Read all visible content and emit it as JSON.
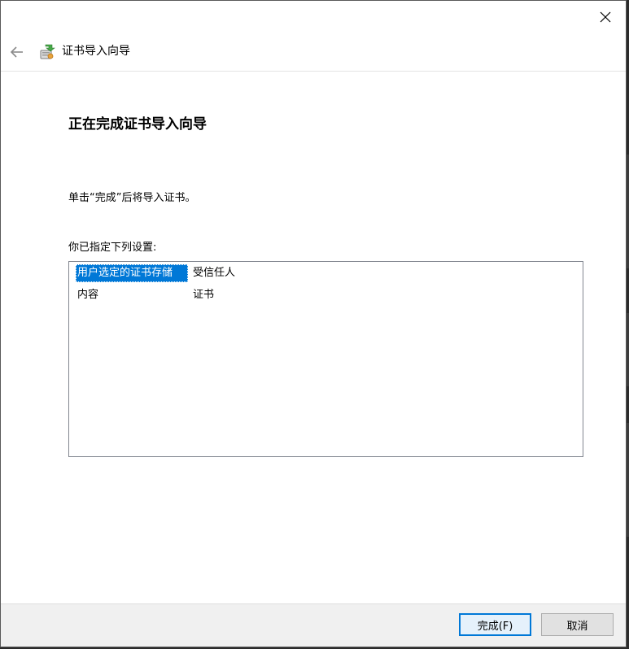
{
  "window": {
    "close_label": "×"
  },
  "nav": {
    "title": "证书导入向导"
  },
  "main": {
    "heading": "正在完成证书导入向导",
    "instruction": "单击“完成”后将导入证书。",
    "settings_label": "你已指定下列设置:",
    "settings": [
      {
        "key": "用户选定的证书存储",
        "value": "受信任人",
        "selected": true
      },
      {
        "key": "内容",
        "value": "证书",
        "selected": false
      }
    ]
  },
  "footer": {
    "finish_label": "完成(F)",
    "cancel_label": "取消"
  },
  "colors": {
    "accent": "#0078d7",
    "footer_bg": "#f0f0f0",
    "list_border": "#828790"
  },
  "icons": {
    "back": "back-arrow-icon",
    "close": "close-icon",
    "wizard": "certificate-wizard-icon"
  }
}
